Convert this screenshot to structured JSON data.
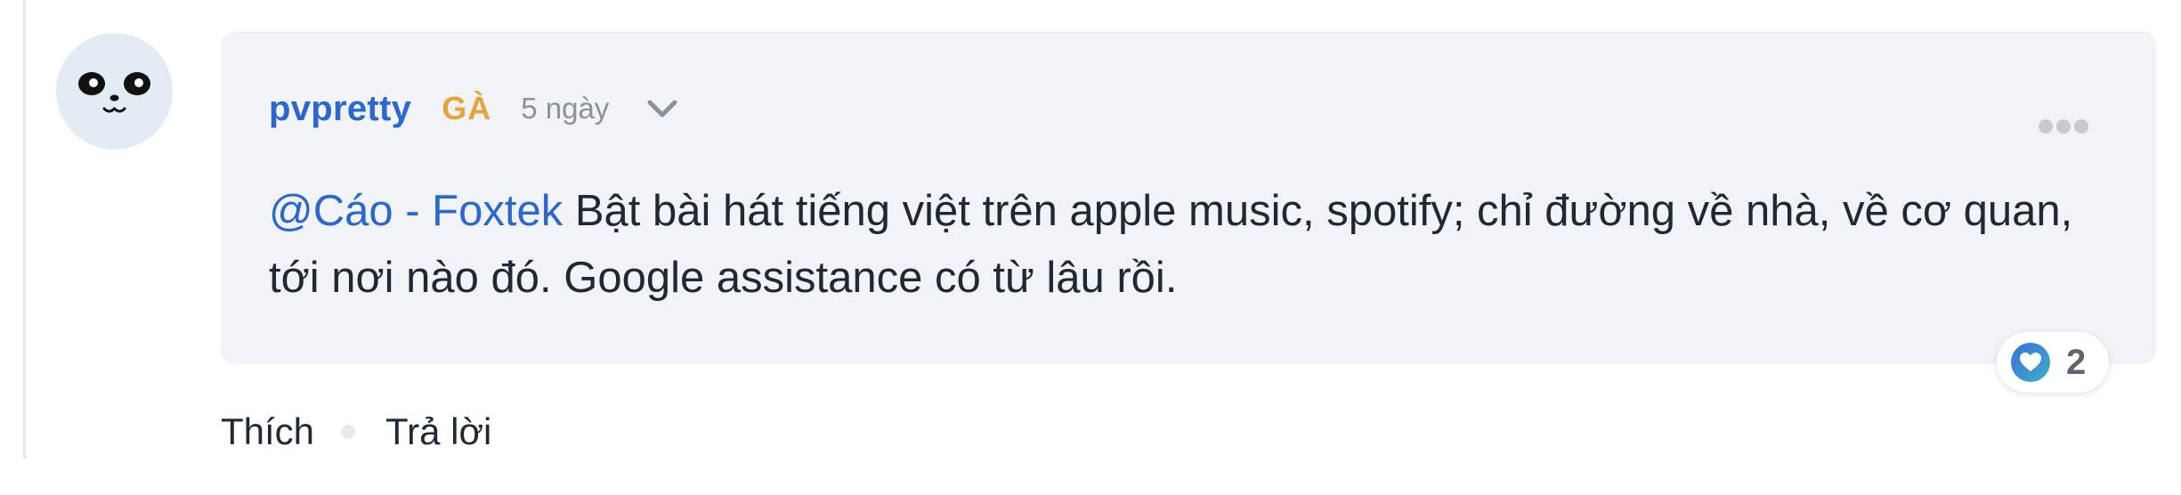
{
  "comment": {
    "username": "pvpretty",
    "rank": "GÀ",
    "time": "5 ngày",
    "mention": "@Cáo - Foxtek",
    "text": " Bật bài hát tiếng việt trên apple music, spotify; chỉ đường về nhà, về cơ quan, tới nơi nào đó. Google assistance có từ lâu rồi.",
    "reaction": {
      "icon": "heart-icon",
      "count": "2"
    },
    "actions": {
      "like": "Thích",
      "reply": "Trả lời"
    }
  },
  "colors": {
    "username": "#2b67d1",
    "rank": "#e8a33c",
    "bubble": "#f1f3f6",
    "text": "#1f2933",
    "muted": "#8a929c"
  }
}
